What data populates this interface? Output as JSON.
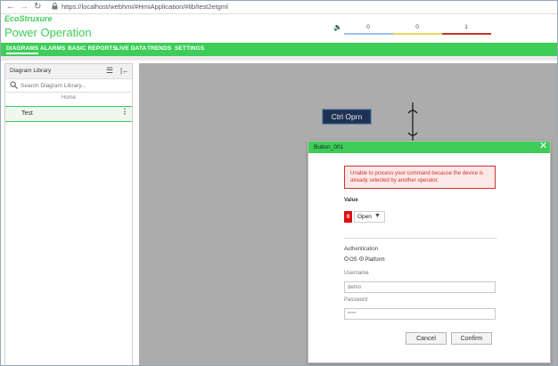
{
  "browser": {
    "back_icon": "back-arrow-icon",
    "forward_icon": "forward-arrow-icon",
    "reload_icon": "reload-icon",
    "url": "https://localhost/webhmi/#HmiApplication/#lib/test2etgml"
  },
  "brand": {
    "logo": "EcoStruxure",
    "title": "Power Operation",
    "color": "#3dcd58"
  },
  "alarms": {
    "counts": [
      "0",
      "0",
      "1"
    ],
    "colors": [
      "#9cc3e6",
      "#ecd55a",
      "#c0392b"
    ]
  },
  "nav": {
    "items": [
      "DIAGRAMS",
      "ALARMS",
      "BASIC REPORTS",
      "LIVE DATA",
      "TRENDS",
      "SETTINGS"
    ],
    "active": "DIAGRAMS"
  },
  "sidebar": {
    "title": "Diagram Library",
    "search_placeholder": "Search Diagram Library...",
    "home_label": "Home",
    "items": [
      {
        "label": "Test"
      }
    ]
  },
  "canvas": {
    "button_label": "Ctrl Oprn"
  },
  "dialog": {
    "title": "Button_001",
    "error": "Unable to process your command because the device is already selected by another operator.",
    "value_label": "Value",
    "value_badge": "0",
    "value_selected": "Open",
    "auth_label": "Authentication",
    "auth_options": [
      "OS",
      "Platform"
    ],
    "auth_selected": "Platform",
    "username_label": "Username",
    "username_value": "demo",
    "password_label": "Password",
    "password_value": "****",
    "cancel_label": "Cancel",
    "confirm_label": "Confirm"
  }
}
